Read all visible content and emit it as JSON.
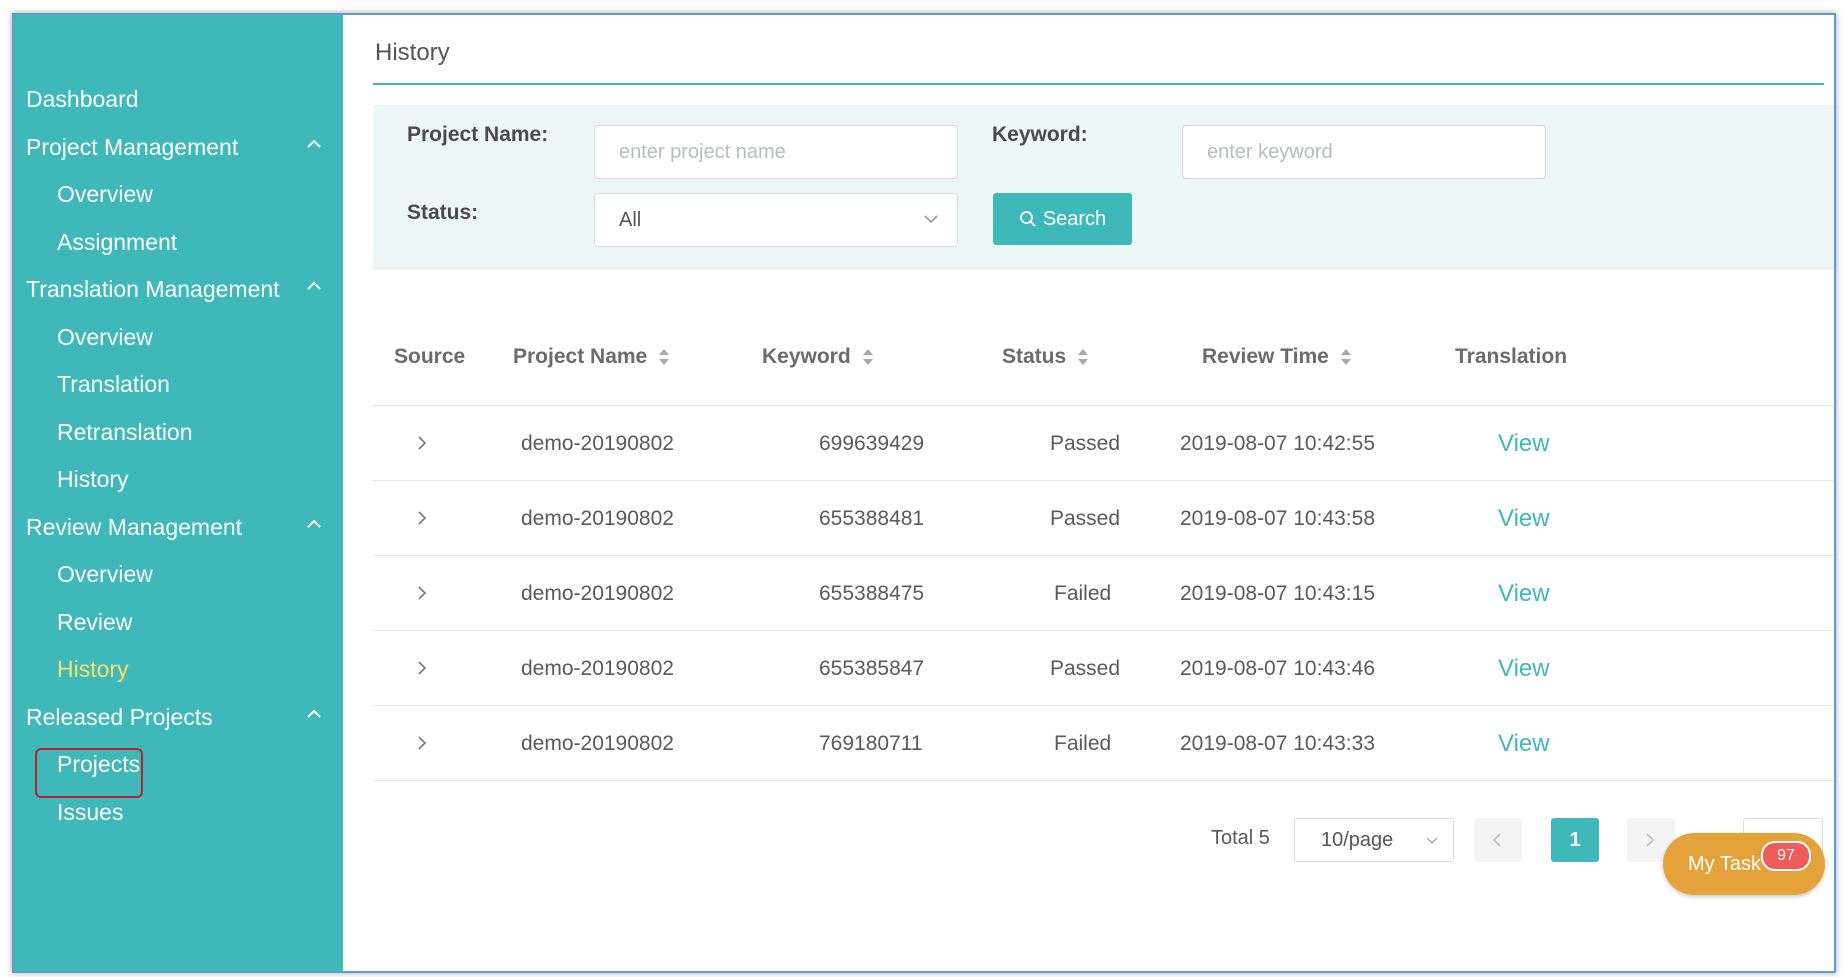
{
  "sidebar": {
    "items": [
      {
        "label": "Dashboard"
      },
      {
        "label": "Project Management"
      },
      {
        "label": "Overview"
      },
      {
        "label": "Assignment"
      },
      {
        "label": "Translation Management"
      },
      {
        "label": "Overview"
      },
      {
        "label": "Translation"
      },
      {
        "label": "Retranslation"
      },
      {
        "label": "History"
      },
      {
        "label": "Review Management"
      },
      {
        "label": "Overview"
      },
      {
        "label": "Review"
      },
      {
        "label": "History"
      },
      {
        "label": "Released Projects"
      },
      {
        "label": "Projects"
      },
      {
        "label": "Issues"
      }
    ],
    "active_color": "#f5e36b",
    "bg_color": "#3eb8b8"
  },
  "page": {
    "title": "History"
  },
  "filters": {
    "project_name_label": "Project Name:",
    "project_name_placeholder": "enter project name",
    "keyword_label": "Keyword:",
    "keyword_placeholder": "enter keyword",
    "status_label": "Status:",
    "status_value": "All",
    "search_label": "Search"
  },
  "table": {
    "columns": [
      "Source",
      "Project Name",
      "Keyword",
      "Status",
      "Review Time",
      "Translation"
    ],
    "rows": [
      {
        "project": "demo-20190802",
        "keyword": "699639429",
        "status": "Passed",
        "time": "2019-08-07 10:42:55",
        "action": "View"
      },
      {
        "project": "demo-20190802",
        "keyword": "655388481",
        "status": "Passed",
        "time": "2019-08-07 10:43:58",
        "action": "View"
      },
      {
        "project": "demo-20190802",
        "keyword": "655388475",
        "status": "Failed",
        "time": "2019-08-07 10:43:15",
        "action": "View"
      },
      {
        "project": "demo-20190802",
        "keyword": "655385847",
        "status": "Passed",
        "time": "2019-08-07 10:43:46",
        "action": "View"
      },
      {
        "project": "demo-20190802",
        "keyword": "769180711",
        "status": "Failed",
        "time": "2019-08-07 10:43:33",
        "action": "View"
      }
    ]
  },
  "pagination": {
    "total_label": "Total 5",
    "page_size": "10/page",
    "current_page": "1"
  },
  "my_task": {
    "label": "My Task",
    "badge": "97",
    "color": "#e4a23a"
  },
  "icons": {
    "chevron_up": "chevron-up-icon",
    "chevron_down": "chevron-down-icon",
    "chevron_right": "chevron-right-icon",
    "chevron_left": "chevron-left-icon",
    "search": "search-icon",
    "sort": "sort-icon"
  }
}
